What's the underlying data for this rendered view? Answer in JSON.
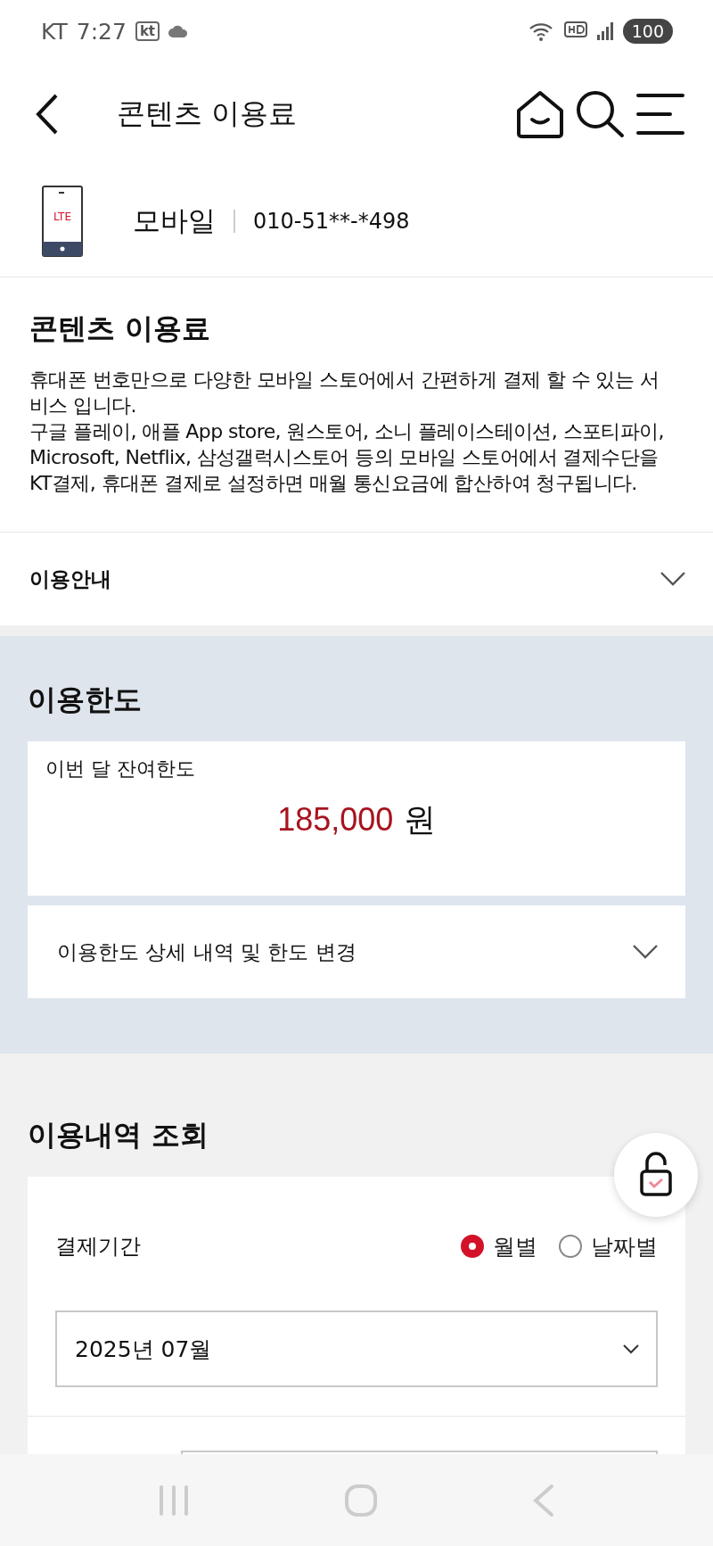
{
  "status_bar": {
    "carrier": "KT",
    "time": "7:27",
    "badge": "kt",
    "battery": "100"
  },
  "header": {
    "title": "콘텐츠 이용료"
  },
  "account": {
    "type": "모바일",
    "device_label": "LTE",
    "number": "010-51**-*498"
  },
  "intro": {
    "title": "콘텐츠 이용료",
    "paragraphs": [
      "휴대폰 번호만으로 다양한 모바일 스토어에서 간편하게 결제 할 수 있는 서비스 입니다.",
      "구글 플레이, 애플 App store, 원스토어, 소니 플레이스테이션, 스포티파이, Microsoft, Netflix, 삼성갤럭시스토어 등의 모바일 스토어에서 결제수단을 KT결제, 휴대폰 결제로 설정하면 매월 통신요금에 합산하여 청구됩니다."
    ]
  },
  "guide": {
    "label": "이용안내",
    "expanded": false
  },
  "limit": {
    "title": "이용한도",
    "remaining_label": "이번 달 잔여한도",
    "amount": "185,000",
    "unit": "원",
    "detail": {
      "label": "이용한도 상세 내역 및 한도 변경",
      "expanded": false
    }
  },
  "history": {
    "title": "이용내역 조회",
    "period_label": "결제기간",
    "options": [
      {
        "label": "월별",
        "selected": true
      },
      {
        "label": "날짜별",
        "selected": false
      }
    ],
    "month": "2025년 07월"
  }
}
